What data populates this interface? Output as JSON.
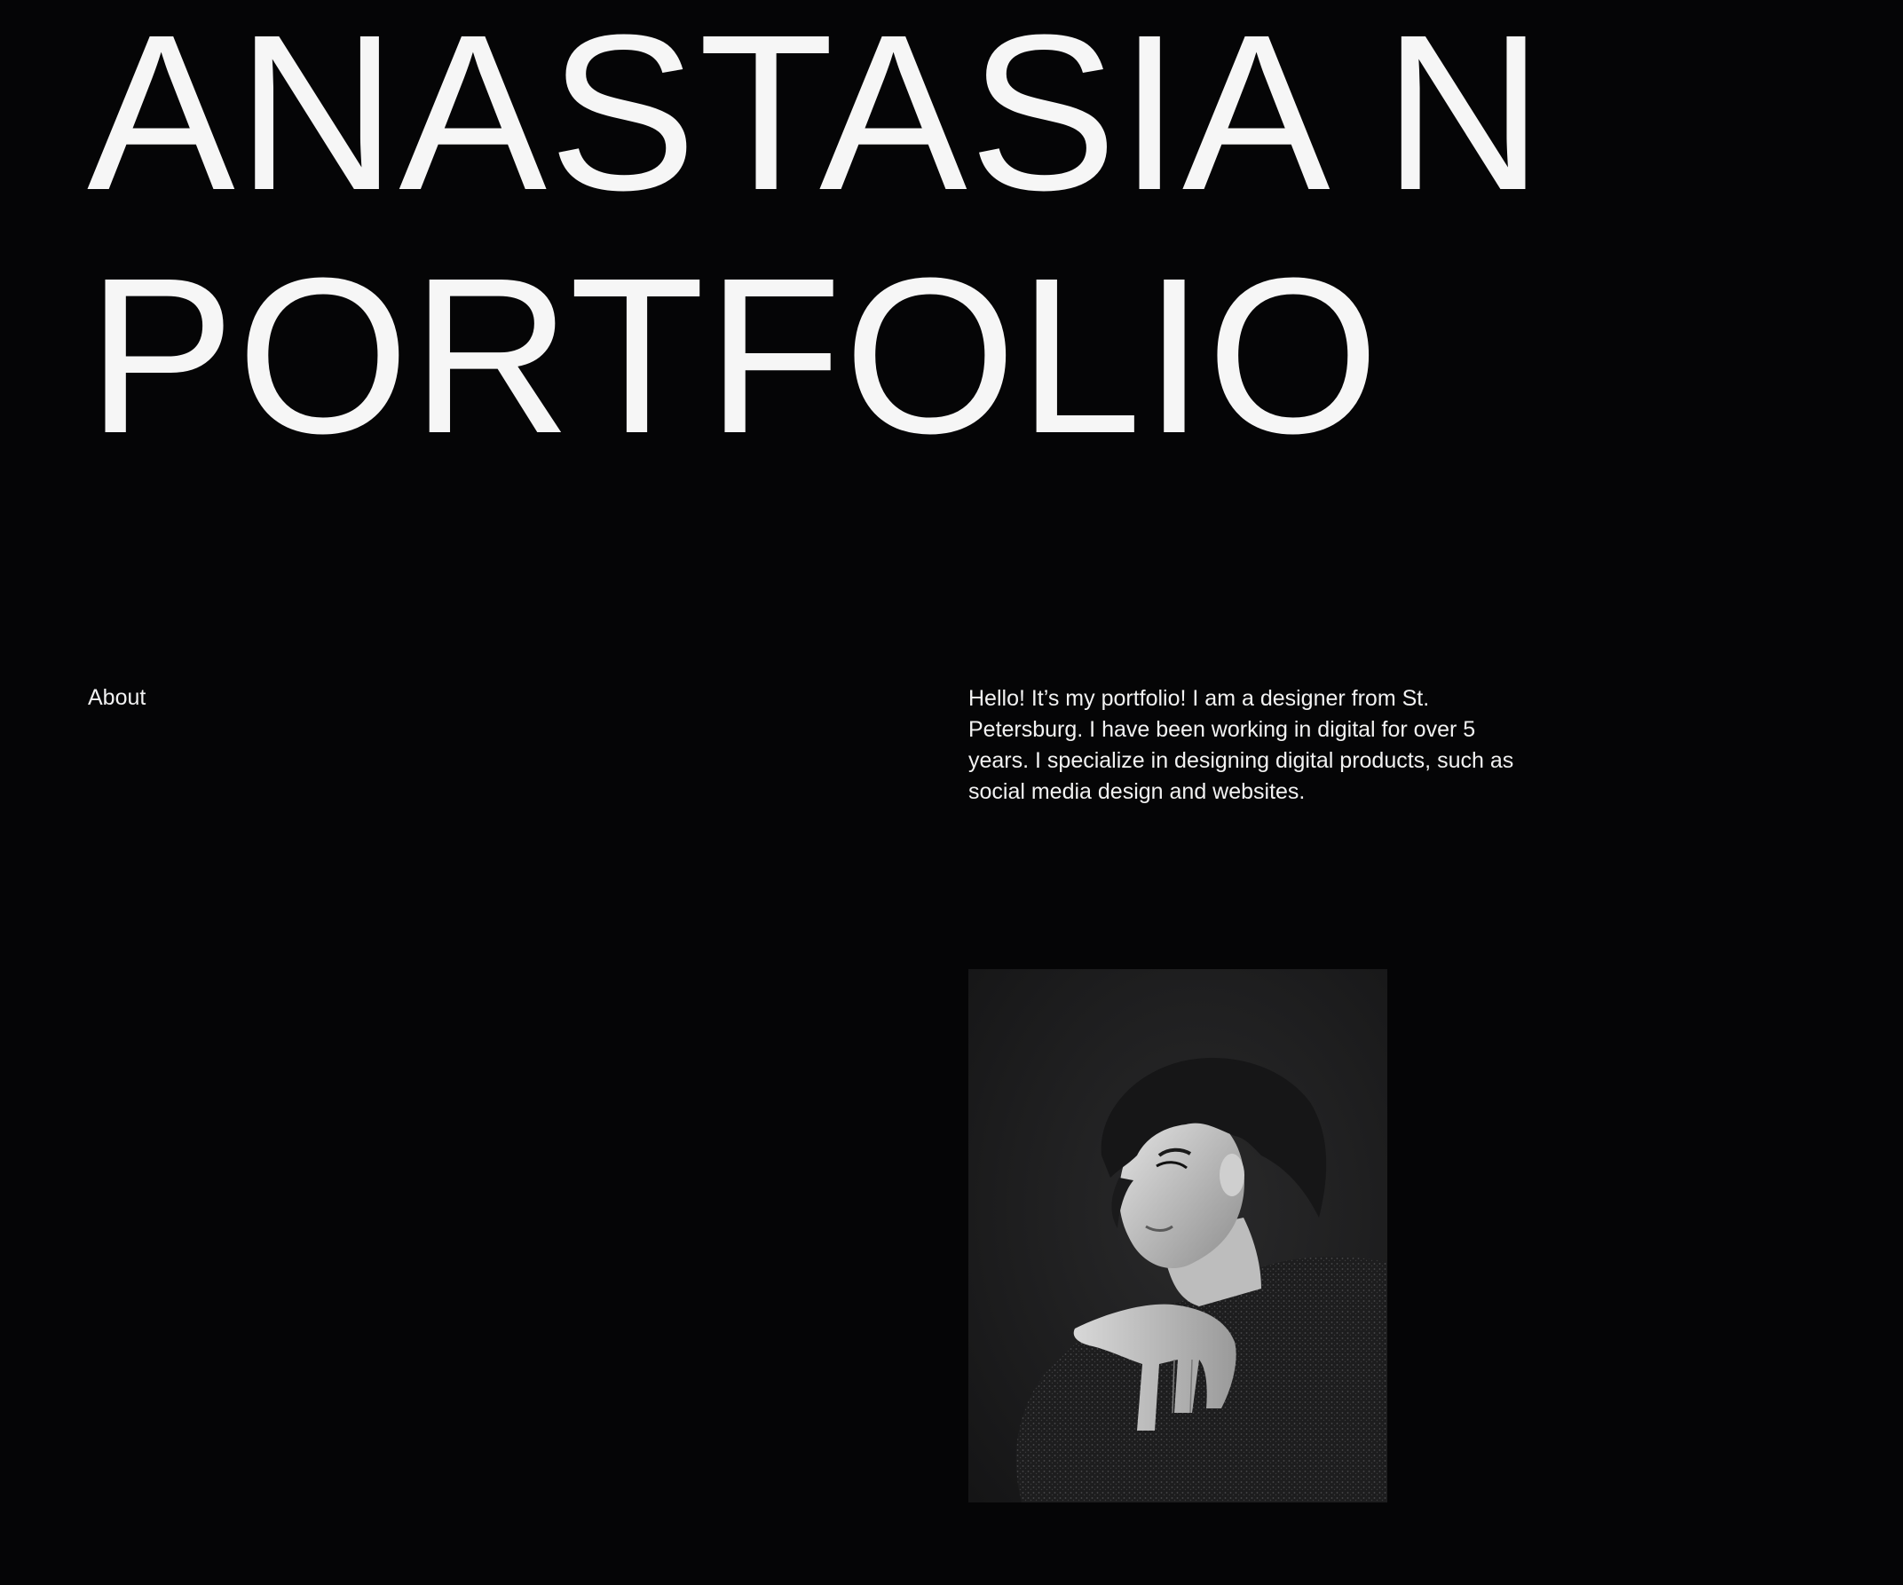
{
  "hero": {
    "line1": "ANASTASIA N",
    "line2": "PORTFOLIO"
  },
  "about": {
    "label": "About",
    "text": "Hello! It’s my portfolio! I am a designer from St. Petersburg. I have been working in digital for over 5 years. I specialize in designing digital products, such as social media design and websites."
  },
  "portrait": {
    "style": "black-and-white"
  },
  "colors": {
    "background": "#050506",
    "text": "#f4f4f4"
  }
}
